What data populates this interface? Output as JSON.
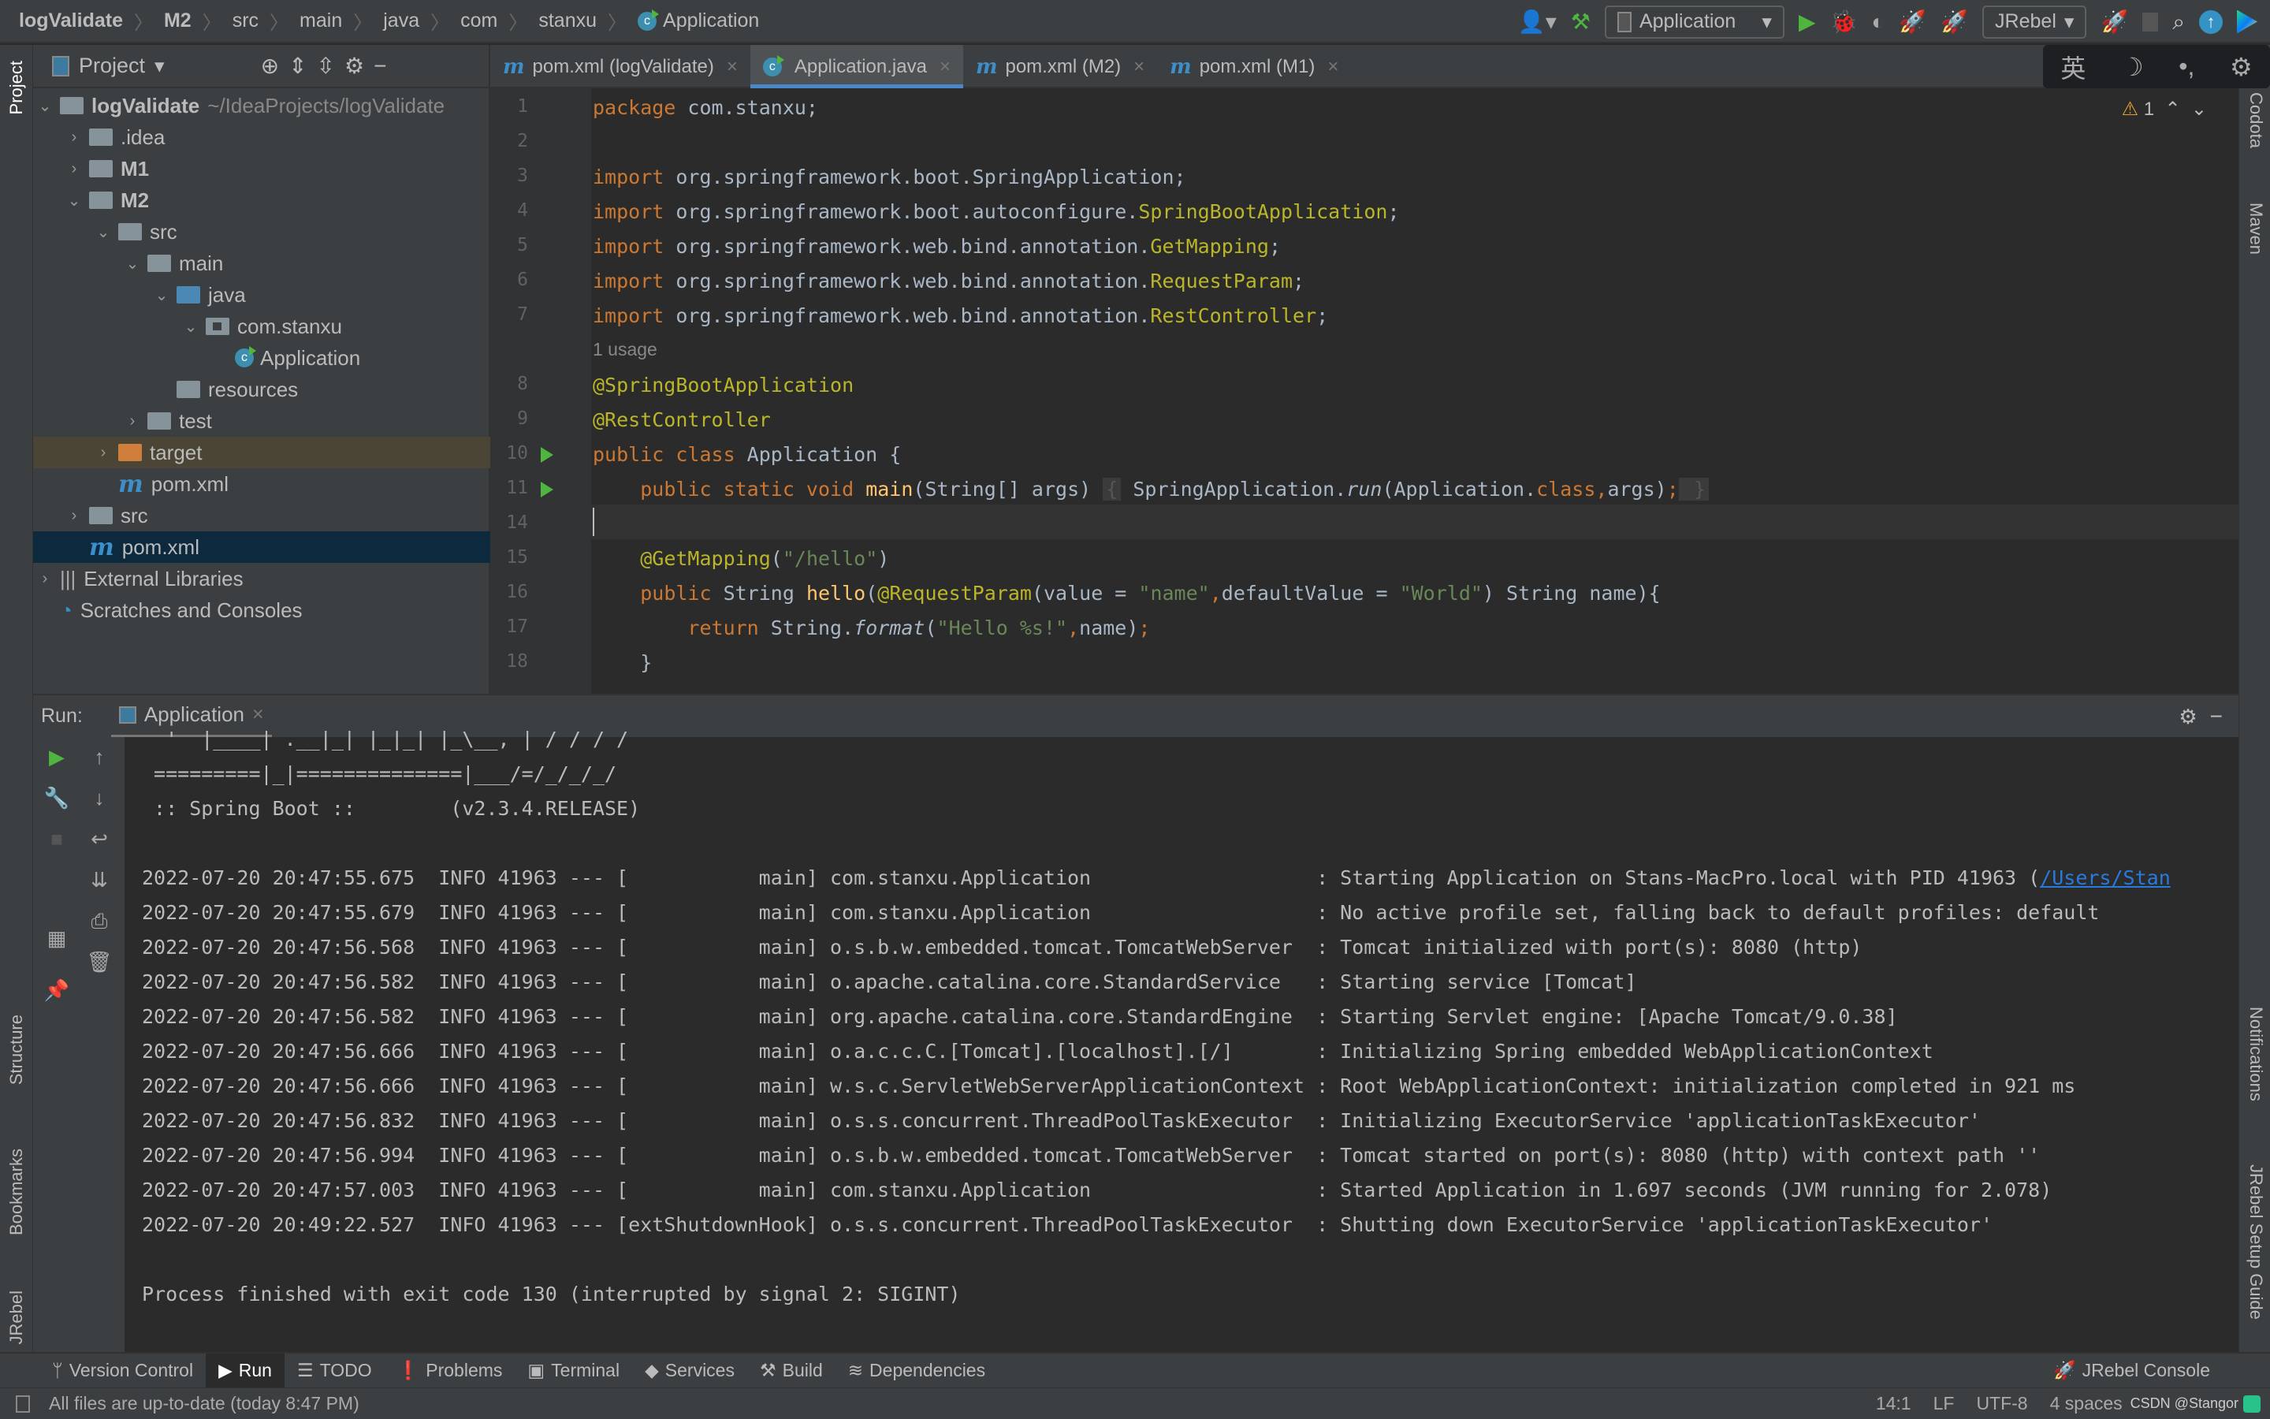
{
  "breadcrumb": [
    "logValidate",
    "M2",
    "src",
    "main",
    "java",
    "com",
    "stanxu",
    "Application"
  ],
  "toolbar": {
    "run_config": "Application",
    "jrebel": "JRebel"
  },
  "ime": {
    "lang": "英",
    "moon": "☽",
    "punct": "•,",
    "gear": "⚙"
  },
  "left_strip": {
    "project": "Project",
    "structure": "Structure",
    "bookmarks": "Bookmarks",
    "jrebel": "JRebel"
  },
  "right_strip": {
    "codota": "Codota",
    "maven": "Maven",
    "notifications": "Notifications",
    "jrebel_setup": "JRebel Setup Guide"
  },
  "project": {
    "title": "Project",
    "tree": [
      {
        "label": "logValidate",
        "extra": "~/IdeaProjects/logValidate",
        "depth": 0,
        "arrow": "down",
        "icon": "folder",
        "bold": true
      },
      {
        "label": ".idea",
        "depth": 1,
        "arrow": "right",
        "icon": "folder"
      },
      {
        "label": "M1",
        "depth": 1,
        "arrow": "right",
        "icon": "folder",
        "bold": true
      },
      {
        "label": "M2",
        "depth": 1,
        "arrow": "down",
        "icon": "folder",
        "bold": true
      },
      {
        "label": "src",
        "depth": 2,
        "arrow": "down",
        "icon": "folder"
      },
      {
        "label": "main",
        "depth": 3,
        "arrow": "down",
        "icon": "folder"
      },
      {
        "label": "java",
        "depth": 4,
        "arrow": "down",
        "icon": "folder-blue"
      },
      {
        "label": "com.stanxu",
        "depth": 5,
        "arrow": "down",
        "icon": "package"
      },
      {
        "label": "Application",
        "depth": 6,
        "arrow": "",
        "icon": "class"
      },
      {
        "label": "resources",
        "depth": 4,
        "arrow": "",
        "icon": "folder"
      },
      {
        "label": "test",
        "depth": 3,
        "arrow": "right",
        "icon": "folder"
      },
      {
        "label": "target",
        "depth": 2,
        "arrow": "right",
        "icon": "folder-orange",
        "state": "target"
      },
      {
        "label": "pom.xml",
        "depth": 2,
        "arrow": "",
        "icon": "maven"
      },
      {
        "label": "src",
        "depth": 1,
        "arrow": "right",
        "icon": "folder"
      },
      {
        "label": "pom.xml",
        "depth": 1,
        "arrow": "",
        "icon": "maven",
        "state": "selected"
      },
      {
        "label": "External Libraries",
        "depth": 0,
        "arrow": "right",
        "icon": "libs"
      },
      {
        "label": "Scratches and Consoles",
        "depth": 0,
        "arrow": "",
        "icon": "scratch"
      }
    ]
  },
  "tabs": [
    {
      "label": "pom.xml (logValidate)",
      "icon": "maven"
    },
    {
      "label": "Application.java",
      "icon": "class",
      "active": true
    },
    {
      "label": "pom.xml (M2)",
      "icon": "maven"
    },
    {
      "label": "pom.xml (M1)",
      "icon": "maven"
    }
  ],
  "editor": {
    "warnings": "1",
    "lines": [
      {
        "n": "1",
        "seg": [
          [
            "kw",
            "package "
          ],
          [
            "",
            "com.stanxu;"
          ]
        ]
      },
      {
        "n": "2",
        "seg": []
      },
      {
        "n": "3",
        "seg": [
          [
            "kw",
            "import "
          ],
          [
            "",
            "org.springframework.boot.SpringApplication;"
          ]
        ]
      },
      {
        "n": "4",
        "seg": [
          [
            "kw",
            "import "
          ],
          [
            "",
            "org.springframework.boot.autoconfigure."
          ],
          [
            "imp",
            "SpringBootApplication"
          ],
          [
            "",
            ";"
          ]
        ]
      },
      {
        "n": "5",
        "seg": [
          [
            "kw",
            "import "
          ],
          [
            "",
            "org.springframework.web.bind.annotation."
          ],
          [
            "imp",
            "GetMapping"
          ],
          [
            "",
            ";"
          ]
        ]
      },
      {
        "n": "6",
        "seg": [
          [
            "kw",
            "import "
          ],
          [
            "",
            "org.springframework.web.bind.annotation."
          ],
          [
            "imp",
            "RequestParam"
          ],
          [
            "",
            ";"
          ]
        ]
      },
      {
        "n": "7",
        "seg": [
          [
            "kw",
            "import "
          ],
          [
            "",
            "org.springframework.web.bind.annotation."
          ],
          [
            "imp",
            "RestController"
          ],
          [
            "",
            ";"
          ]
        ]
      },
      {
        "n": "",
        "hint": "1 usage"
      },
      {
        "n": "8",
        "seg": [
          [
            "ann",
            "@SpringBootApplication"
          ]
        ]
      },
      {
        "n": "9",
        "seg": [
          [
            "ann",
            "@RestController"
          ]
        ]
      },
      {
        "n": "10",
        "run": true,
        "seg": [
          [
            "kw",
            "public class "
          ],
          [
            "",
            "Application {"
          ]
        ]
      },
      {
        "n": "11",
        "run": true,
        "seg": [
          [
            "",
            "    "
          ],
          [
            "kw",
            "public static void "
          ],
          [
            "fn",
            "main"
          ],
          [
            "",
            "(String[] args) "
          ],
          [
            "fold",
            "{"
          ],
          [
            "",
            " SpringApplication."
          ],
          [
            "it",
            "run"
          ],
          [
            "",
            "(Application."
          ],
          [
            "kw",
            "class"
          ],
          [
            "kw",
            ","
          ],
          [
            "",
            "args)"
          ],
          [
            "kw",
            ";"
          ],
          [
            "",
            ""
          ],
          [
            "fold",
            " }"
          ]
        ]
      },
      {
        "n": "14",
        "seg": []
      },
      {
        "n": "15",
        "seg": [
          [
            "",
            "    "
          ],
          [
            "ann",
            "@GetMapping"
          ],
          [
            "",
            "("
          ],
          [
            "str",
            "\"/hello\""
          ],
          [
            "",
            ")"
          ]
        ]
      },
      {
        "n": "16",
        "seg": [
          [
            "",
            "    "
          ],
          [
            "kw",
            "public "
          ],
          [
            "",
            "String "
          ],
          [
            "fn",
            "hello"
          ],
          [
            "",
            "("
          ],
          [
            "ann",
            "@RequestParam"
          ],
          [
            "",
            "(value = "
          ],
          [
            "str",
            "\"name\""
          ],
          [
            "kw",
            ","
          ],
          [
            "",
            "defaultValue = "
          ],
          [
            "str",
            "\"World\""
          ],
          [
            "",
            ") String name){"
          ]
        ]
      },
      {
        "n": "17",
        "seg": [
          [
            "",
            "        "
          ],
          [
            "kw",
            "return "
          ],
          [
            "",
            "String."
          ],
          [
            "it",
            "format"
          ],
          [
            "",
            "("
          ],
          [
            "str",
            "\"Hello %s!\""
          ],
          [
            "kw",
            ","
          ],
          [
            "",
            "name)"
          ],
          [
            "kw",
            ";"
          ]
        ]
      },
      {
        "n": "18",
        "seg": [
          [
            "",
            "    }"
          ]
        ]
      }
    ]
  },
  "run": {
    "label": "Run:",
    "tab": "Application",
    "lines": [
      {
        "text": "  '  |____| .__|_| |_|_| |_\\__, | / / / /"
      },
      {
        "text": " =========|_|==============|___/=/_/_/_/"
      },
      {
        "text": " :: Spring Boot ::        (v2.3.4.RELEASE)"
      },
      {
        "text": ""
      },
      {
        "text": "2022-07-20 20:47:55.675  INFO 41963 --- [           main] com.stanxu.Application                   : Starting Application on Stans-MacPro.local with PID 41963 (",
        "link": "/Users/Stan"
      },
      {
        "text": "2022-07-20 20:47:55.679  INFO 41963 --- [           main] com.stanxu.Application                   : No active profile set, falling back to default profiles: default"
      },
      {
        "text": "2022-07-20 20:47:56.568  INFO 41963 --- [           main] o.s.b.w.embedded.tomcat.TomcatWebServer  : Tomcat initialized with port(s): 8080 (http)"
      },
      {
        "text": "2022-07-20 20:47:56.582  INFO 41963 --- [           main] o.apache.catalina.core.StandardService   : Starting service [Tomcat]"
      },
      {
        "text": "2022-07-20 20:47:56.582  INFO 41963 --- [           main] org.apache.catalina.core.StandardEngine  : Starting Servlet engine: [Apache Tomcat/9.0.38]"
      },
      {
        "text": "2022-07-20 20:47:56.666  INFO 41963 --- [           main] o.a.c.c.C.[Tomcat].[localhost].[/]       : Initializing Spring embedded WebApplicationContext"
      },
      {
        "text": "2022-07-20 20:47:56.666  INFO 41963 --- [           main] w.s.c.ServletWebServerApplicationContext : Root WebApplicationContext: initialization completed in 921 ms"
      },
      {
        "text": "2022-07-20 20:47:56.832  INFO 41963 --- [           main] o.s.s.concurrent.ThreadPoolTaskExecutor  : Initializing ExecutorService 'applicationTaskExecutor'"
      },
      {
        "text": "2022-07-20 20:47:56.994  INFO 41963 --- [           main] o.s.b.w.embedded.tomcat.TomcatWebServer  : Tomcat started on port(s): 8080 (http) with context path ''"
      },
      {
        "text": "2022-07-20 20:47:57.003  INFO 41963 --- [           main] com.stanxu.Application                   : Started Application in 1.697 seconds (JVM running for 2.078)"
      },
      {
        "text": "2022-07-20 20:49:22.527  INFO 41963 --- [extShutdownHook] o.s.s.concurrent.ThreadPoolTaskExecutor  : Shutting down ExecutorService 'applicationTaskExecutor'"
      },
      {
        "text": ""
      },
      {
        "text": "Process finished with exit code 130 (interrupted by signal 2: SIGINT)"
      }
    ]
  },
  "toolwindows": [
    {
      "label": "Version Control",
      "icon": "ᛘ"
    },
    {
      "label": "Run",
      "icon": "▶",
      "active": true
    },
    {
      "label": "TODO",
      "icon": "☰"
    },
    {
      "label": "Problems",
      "icon": "❗"
    },
    {
      "label": "Terminal",
      "icon": "▣"
    },
    {
      "label": "Services",
      "icon": "◆"
    },
    {
      "label": "Build",
      "icon": "⚒"
    },
    {
      "label": "Dependencies",
      "icon": "≋"
    }
  ],
  "jrebel_console": "JRebel Console",
  "status": {
    "message": "All files are up-to-date (today 8:47 PM)",
    "position": "14:1",
    "line_sep": "LF",
    "encoding": "UTF-8",
    "indent": "4 spaces",
    "watermark": "CSDN @Stangor"
  },
  "colors": {
    "accent": "#4a88c7",
    "run_green": "#4fb540",
    "keyword": "#cc7832",
    "annotation": "#bbb529",
    "string": "#6a8759"
  }
}
